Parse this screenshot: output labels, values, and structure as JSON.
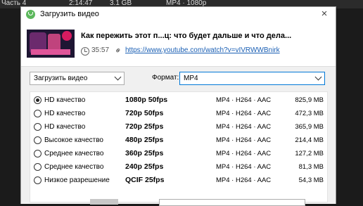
{
  "background": {
    "segment_title": "Часть 4",
    "duration": "2:14:47",
    "size": "3.1 GB",
    "format": "MP4 · 1080p"
  },
  "dialog": {
    "title": "Загрузить видео",
    "close_symbol": "×"
  },
  "video": {
    "title": "Как пережить этот п...ц: что будет дальше и что дела...",
    "duration": "35:57",
    "url": "https://www.youtube.com/watch?v=vIVRWWBnirk"
  },
  "action": {
    "selected": "Загрузить видео"
  },
  "format": {
    "label": "Формат:",
    "selected": "MP4"
  },
  "qualities": [
    {
      "label": "HD качество",
      "resolution": "1080p 50fps",
      "codec": "MP4 · H264 · AAC",
      "size": "825,9 MB",
      "selected": true
    },
    {
      "label": "HD качество",
      "resolution": "720p 50fps",
      "codec": "MP4 · H264 · AAC",
      "size": "472,3 MB",
      "selected": false
    },
    {
      "label": "HD качество",
      "resolution": "720p 25fps",
      "codec": "MP4 · H264 · AAC",
      "size": "365,9 MB",
      "selected": false
    },
    {
      "label": "Высокое качество",
      "resolution": "480p 25fps",
      "codec": "MP4 · H264 · AAC",
      "size": "214,4 MB",
      "selected": false
    },
    {
      "label": "Среднее качество",
      "resolution": "360p 25fps",
      "codec": "MP4 · H264 · AAC",
      "size": "127,2 MB",
      "selected": false
    },
    {
      "label": "Среднее качество",
      "resolution": "240p 25fps",
      "codec": "MP4 · H264 · AAC",
      "size": "81,3 MB",
      "selected": false
    },
    {
      "label": "Низкое разрешение",
      "resolution": "QCIF 25fps",
      "codec": "MP4 · H264 · AAC",
      "size": "54,3 MB",
      "selected": false
    }
  ],
  "icons": {
    "app": "app-logo-icon",
    "clock": "clock-icon",
    "link": "link-icon",
    "chevron": "chevron-down-icon"
  }
}
